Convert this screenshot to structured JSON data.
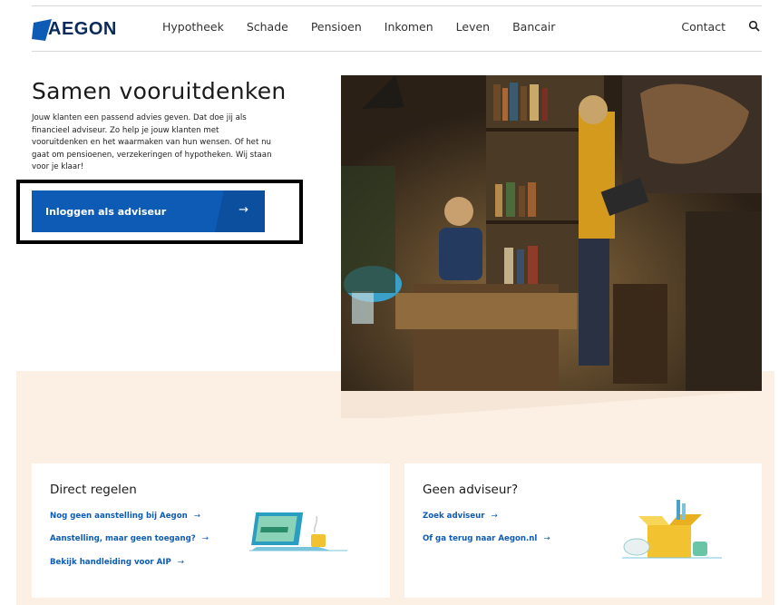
{
  "header": {
    "logo_text": "AEGON",
    "nav": [
      "Hypotheek",
      "Schade",
      "Pensioen",
      "Inkomen",
      "Leven",
      "Bancair"
    ],
    "contact": "Contact",
    "search_icon": "search-icon"
  },
  "hero": {
    "title": "Samen vooruitdenken",
    "text": "Jouw klanten een passend advies geven. Dat doe jij als financieel adviseur. Zo help je jouw klanten met vooruitdenken en het waarmaken van hun wensen. Of het nu gaat om pensioenen, verzekeringen of hypotheken. Wij staan voor je klaar!",
    "button_label": "Inloggen als adviseur",
    "button_arrow": "→"
  },
  "cards": [
    {
      "title": "Direct regelen",
      "links": [
        "Nog geen aanstelling bij Aegon",
        "Aanstelling, maar geen toegang?",
        "Bekijk handleiding voor AIP"
      ]
    },
    {
      "title": "Geen adviseur?",
      "links": [
        "Zoek adviseur",
        "Of ga terug naar Aegon.nl"
      ]
    }
  ],
  "colors": {
    "brand_blue": "#0e5bb5",
    "beige": "#fcefe3"
  }
}
